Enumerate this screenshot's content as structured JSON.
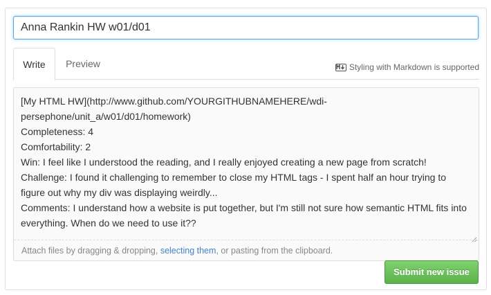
{
  "issue_title": {
    "value": "Anna Rankin HW w01/d01"
  },
  "tabs": [
    {
      "label": "Write",
      "active": true
    },
    {
      "label": "Preview",
      "active": false
    }
  ],
  "markdown_note": {
    "icon": "markdown-icon",
    "text": "Styling with Markdown is supported"
  },
  "editor": {
    "body": "[My HTML HW](http://www.github.com/YOURGITHUBNAMEHERE/wdi-\npersephone/unit_a/w01/d01/homework)\nCompleteness: 4\nComfortability: 2\nWin: I feel like I understood the reading, and I really enjoyed creating a new page from scratch!\nChallenge: I found it challenging to remember to close my HTML tags - I spent half an hour trying to\nfigure out why my div was displaying weirdly...\nComments: I understand how a website is put together, but I'm still not sure how semantic HTML fits into\neverything. When do we need to use it??"
  },
  "attach_bar": {
    "prefix": "Attach files by dragging & dropping, ",
    "link": "selecting them",
    "suffix": ", or pasting from the clipboard."
  },
  "submit": {
    "label": "Submit new issue",
    "color": "#5db14d"
  },
  "colors": {
    "focus_border": "#51a7e8",
    "link": "#4183c4"
  }
}
